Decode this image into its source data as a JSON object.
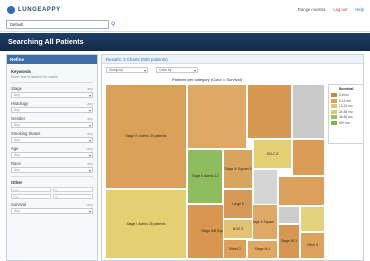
{
  "header": {
    "logo_text": "LUNGEAPPY",
    "user_label": "Range nuestra",
    "logout_label": "Log out",
    "help_label": "Help"
  },
  "search": {
    "value": "Default"
  },
  "page": {
    "title": "Searching All Patients"
  },
  "sidebar": {
    "heading": "Refine",
    "keywords_label": "Keywords",
    "keywords_hint": "Enter text to search for cases",
    "filters": [
      {
        "name": "Stage",
        "any": "any",
        "select": "Any"
      },
      {
        "name": "Histology",
        "any": "any",
        "select": "Any"
      },
      {
        "name": "Gender",
        "any": "any",
        "select": "Any"
      },
      {
        "name": "Smoking Status",
        "any": "any",
        "select": "Any"
      },
      {
        "name": "Age",
        "any": "any",
        "select": "Any"
      },
      {
        "name": "Race",
        "any": "any",
        "select": "Any"
      },
      {
        "name": "Survival",
        "any": "any",
        "select": "Any"
      }
    ],
    "extra_label": "Other",
    "range_labels": [
      "from",
      "to",
      "from",
      "to"
    ]
  },
  "results": {
    "heading": "Results: 3 Charts (600 patients)",
    "group_by": "Group by",
    "color_by": "Color by",
    "chart_title": "Patients per category (Color = Survival)"
  },
  "treemap": {
    "tiles": [
      {
        "label": "Stage IV Adeno 34 patients",
        "color": "#d9a15a"
      },
      {
        "label": "Stage I Adeno 26 patients",
        "color": "#e4cf72"
      },
      {
        "label": "",
        "color": "#e0a867"
      },
      {
        "label": "",
        "color": "#d89752"
      },
      {
        "label": "",
        "color": "#c9c9c9"
      },
      {
        "label": "",
        "color": "#dd9c56"
      },
      {
        "label": "Stage II Adeno 12",
        "color": "#8dbd5f"
      },
      {
        "label": "Stage III Squam 9",
        "color": "#d8a55e"
      },
      {
        "label": "SCLC 8",
        "color": "#e4cf72"
      },
      {
        "label": "",
        "color": "#d5d5d5"
      },
      {
        "label": "",
        "color": "#dda05c"
      },
      {
        "label": "Stage IIIB Squam 14",
        "color": "#d89650"
      },
      {
        "label": "Stage II Squam",
        "color": "#e0a867"
      },
      {
        "label": "Large 6",
        "color": "#d69a58"
      },
      {
        "label": "",
        "color": "#cccccc"
      },
      {
        "label": "",
        "color": "#e4d37c"
      },
      {
        "label": "Other 5",
        "color": "#dca25e"
      },
      {
        "label": "Stage IA 4",
        "color": "#e1a864"
      },
      {
        "label": "Stage IB 3",
        "color": "#d79752"
      },
      {
        "label": "NOS 3",
        "color": "#e3c274"
      },
      {
        "label": "Mixed 2",
        "color": "#dda05c"
      }
    ]
  },
  "legend": {
    "title": "Survival",
    "items": [
      {
        "label": "0-6 mo",
        "color": "#c98a3e"
      },
      {
        "label": "6-12 mo",
        "color": "#d8a55e"
      },
      {
        "label": "12-24 mo",
        "color": "#e3c56e"
      },
      {
        "label": "24-36 mo",
        "color": "#c9d36f"
      },
      {
        "label": "36-60 mo",
        "color": "#9fc060"
      },
      {
        "label": "60+ mo",
        "color": "#7fb457"
      }
    ]
  }
}
